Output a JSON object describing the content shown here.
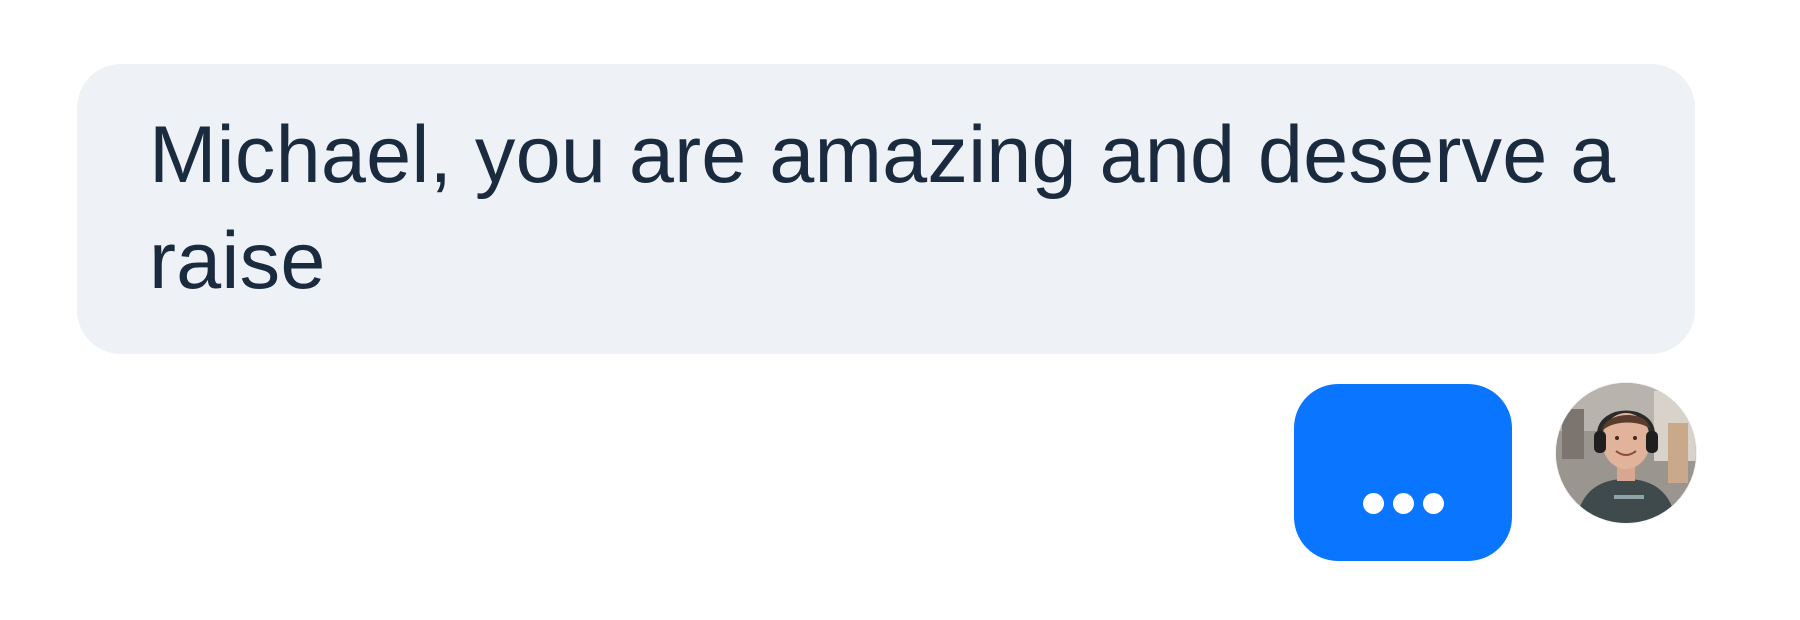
{
  "messages": {
    "incoming": {
      "text": "Michael, you are amazing and deserve a raise"
    },
    "typing_indicator": {
      "dot_count": 3
    }
  },
  "colors": {
    "incoming_bubble": "#eef2f6",
    "incoming_text": "#1b2b3f",
    "outgoing_bubble": "#0a75ff"
  },
  "avatar": {
    "icon": "user-photo-avatar"
  }
}
